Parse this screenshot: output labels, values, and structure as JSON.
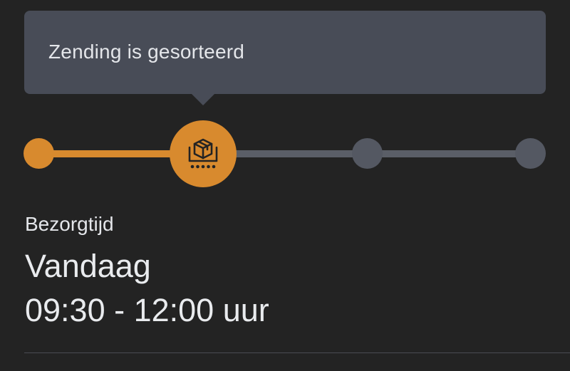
{
  "tooltip": {
    "message": "Zending is gesorteerd"
  },
  "progress": {
    "steps_total": 4,
    "current_step": 2,
    "current_step_icon": "package-on-conveyor-icon",
    "colors": {
      "done": "#d88a2e",
      "todo": "#545862"
    }
  },
  "delivery": {
    "label": "Bezorgtijd",
    "day": "Vandaag",
    "time_window": "09:30 - 12:00 uur"
  }
}
